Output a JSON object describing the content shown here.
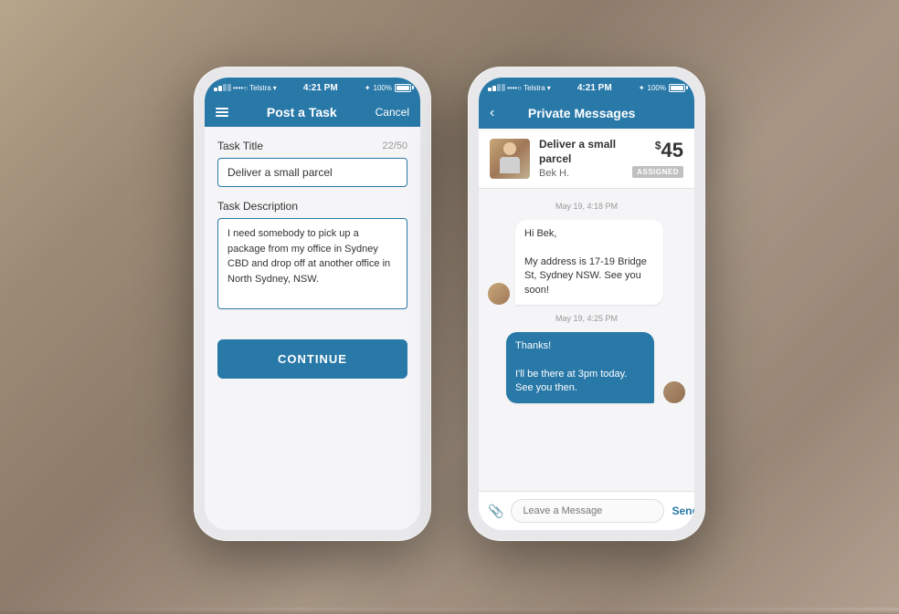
{
  "background": {
    "description": "Blurred cafe background"
  },
  "phone1": {
    "statusBar": {
      "carrier": "••••○ Telstra",
      "wifi": "WiFi",
      "time": "4:21 PM",
      "bluetooth": "BT",
      "battery": "100%"
    },
    "navBar": {
      "menuIcon": "≡",
      "title": "Post a Task",
      "cancelLabel": "Cancel"
    },
    "taskTitleLabel": "Task Title",
    "taskTitleCount": "22/50",
    "taskTitleValue": "Deliver a small parcel",
    "taskDescriptionLabel": "Task Description",
    "taskDescriptionValue": "I need somebody to pick up a package from my office in Sydney CBD and drop off at another office in North Sydney, NSW.",
    "continueButton": "CONTINUE"
  },
  "phone2": {
    "statusBar": {
      "carrier": "••••○ Telstra",
      "wifi": "WiFi",
      "time": "4:21 PM",
      "bluetooth": "BT",
      "battery": "100%"
    },
    "navBar": {
      "backIcon": "‹",
      "title": "Private Messages"
    },
    "taskCard": {
      "taskName": "Deliver a small parcel",
      "assignedTo": "Bek H.",
      "price": "$45",
      "priceSymbol": "$",
      "priceAmount": "45",
      "status": "ASSIGNED"
    },
    "messages": [
      {
        "date": "May 19, 4:18 PM",
        "side": "received",
        "text": "Hi Bek,\n\nMy address is 17-19 Bridge St, Sydney NSW. See you soon!"
      },
      {
        "date": "May 19, 4:25 PM",
        "side": "sent",
        "text": "Thanks!\n\nI'll be there at 3pm today. See you then."
      }
    ],
    "inputPlaceholder": "Leave a Message",
    "sendLabel": "Send"
  }
}
